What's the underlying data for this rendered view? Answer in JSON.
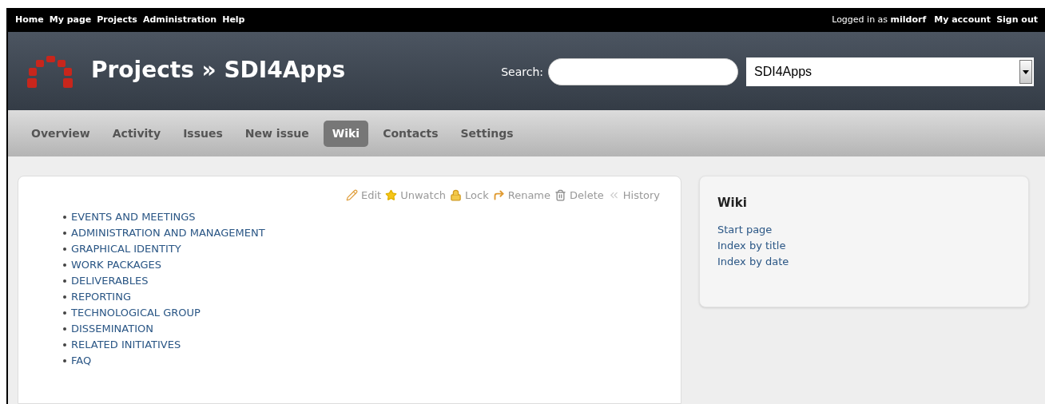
{
  "top_menu": [
    "Home",
    "My page",
    "Projects",
    "Administration",
    "Help"
  ],
  "account": {
    "logged_in": "Logged in as **mildorf**",
    "links": [
      "My account",
      "Sign out"
    ]
  },
  "header": {
    "title": "Projects » SDI4Apps",
    "search_label": "Search:",
    "project_select": "SDI4Apps"
  },
  "tabs": [
    {
      "label": "Overview",
      "selected": false
    },
    {
      "label": "Activity",
      "selected": false
    },
    {
      "label": "Issues",
      "selected": false
    },
    {
      "label": "New issue",
      "selected": false
    },
    {
      "label": "Wiki",
      "selected": true
    },
    {
      "label": "Contacts",
      "selected": false
    },
    {
      "label": "Settings",
      "selected": false
    }
  ],
  "actions": [
    {
      "kind": "edit",
      "label": "Edit"
    },
    {
      "kind": "unwatch",
      "label": "Unwatch"
    },
    {
      "kind": "lock",
      "label": "Lock"
    },
    {
      "kind": "rename",
      "label": "Rename"
    },
    {
      "kind": "delete",
      "label": "Delete"
    },
    {
      "kind": "history",
      "label": "History"
    }
  ],
  "pages": [
    "EVENTS AND MEETINGS",
    "ADMINISTRATION AND MANAGEMENT",
    "GRAPHICAL IDENTITY",
    "WORK PACKAGES",
    "DELIVERABLES",
    "REPORTING",
    "TECHNOLOGICAL GROUP",
    "DISSEMINATION",
    "RELATED INITIATIVES",
    "FAQ"
  ],
  "sidebar": {
    "title": "Wiki",
    "links": [
      "Start page",
      "Index by title",
      "Index by date"
    ]
  }
}
